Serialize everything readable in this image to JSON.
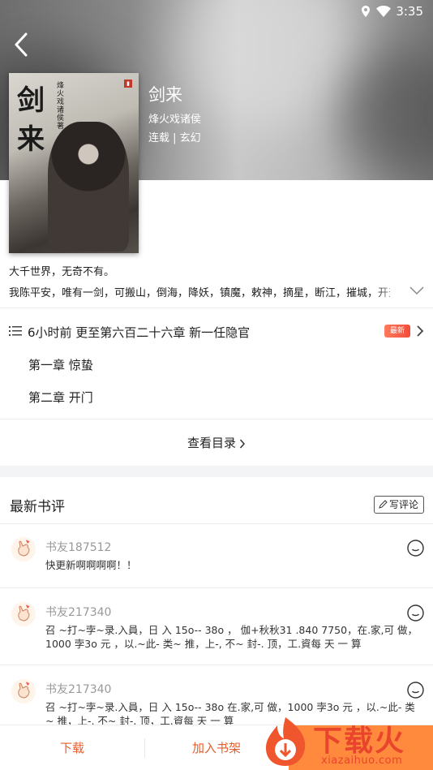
{
  "status_bar": {
    "time": "3:35"
  },
  "book": {
    "title": "剑来",
    "author": "烽火戏诸侯",
    "meta": "连载 | 玄幻",
    "cover_title": "剑来",
    "cover_author_text": "烽火戏诸侯著",
    "intro_line1": "大千世界，无奇不有。",
    "intro_line2": "我陈平安，唯有一剑，可搬山，倒海，降妖，镇魔，敕神，摘星，断江，摧城，开天！"
  },
  "chapters": {
    "latest": "6小时前 更至第六百二十六章 新一任隐官",
    "new_badge": "最新",
    "list": [
      "第一章 惊蛰",
      "第二章 开门"
    ],
    "toc_link": "查看目录"
  },
  "reviews": {
    "title": "最新书评",
    "write_button": "写评论",
    "items": [
      {
        "name": "书友187512",
        "content": "快更新啊啊啊啊！！"
      },
      {
        "name": "书友217340",
        "content": "召 ~打~孛~录.入員，日 入 15o-- 38o ， 伽+秋秋31 .840 7750，在.家,可 做，1000 孛3o 元 ，以.~此- 类~ 推，上-, 不~ 封-. 顶，工.資每 天 一 算"
      },
      {
        "name": "书友217340",
        "content": "召 ~打~孛~录.入員，日 入 15o-- 38o 在.家,可 做，1000 孛3o 元 ，以.~此- 类~ 推，上-, 不~ 封-. 顶，工.資每 天 一 算"
      }
    ]
  },
  "bottom_bar": {
    "download": "下载",
    "add_shelf": "加入书架"
  },
  "watermark": {
    "text": "下载火",
    "url": "xiazaihuo.com"
  },
  "colors": {
    "accent": "#e85d2c",
    "badge": "#f24b3a"
  }
}
